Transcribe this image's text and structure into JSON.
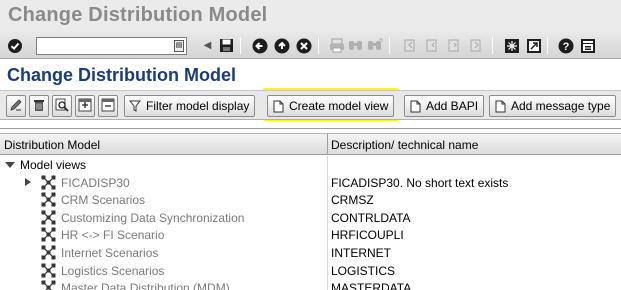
{
  "window": {
    "title": "Change Distribution Model"
  },
  "system_toolbar": {
    "command_field": {
      "value": "",
      "placeholder": ""
    },
    "icons": [
      "enter-icon",
      "command-history-icon",
      "back-arrow-icon",
      "save-icon",
      "back-icon",
      "exit-icon",
      "cancel-icon",
      "print-icon",
      "find-icon",
      "find-next-icon",
      "first-page-icon",
      "previous-page-icon",
      "next-page-icon",
      "last-page-icon",
      "new-session-icon",
      "create-shortcut-icon",
      "help-icon",
      "customize-layout-icon"
    ]
  },
  "screen": {
    "title": "Change Distribution Model"
  },
  "app_toolbar": {
    "filter_label": "Filter model display",
    "create_view_label": "Create model view",
    "add_bapi_label": "Add BAPI",
    "add_message_type_label": "Add message type",
    "highlight_color": "#f5f500"
  },
  "grid": {
    "columns": [
      "Distribution Model",
      "Description/ technical name"
    ],
    "root": {
      "label": "Model views"
    },
    "rows": [
      {
        "name": "FICADISP30",
        "desc": "FICADISP30. No short text exists",
        "expandable": true
      },
      {
        "name": "CRM Scenarios",
        "desc": "CRMSZ",
        "expandable": false
      },
      {
        "name": "Customizing Data Synchronization",
        "desc": "CONTRLDATA",
        "expandable": false
      },
      {
        "name": "HR <-> FI Scenario",
        "desc": "HRFICOUPLI",
        "expandable": false
      },
      {
        "name": "Internet Scenarios",
        "desc": "INTERNET",
        "expandable": false
      },
      {
        "name": "Logistics Scenarios",
        "desc": "LOGISTICS",
        "expandable": false
      },
      {
        "name": "Master Data Distribution (MDM)",
        "desc": "MASTERDATA",
        "expandable": false
      }
    ]
  }
}
